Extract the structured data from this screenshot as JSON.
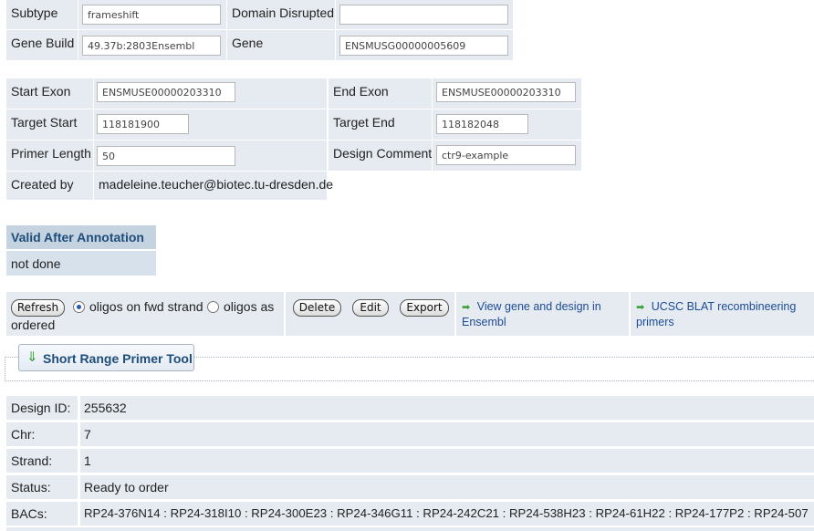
{
  "top_table": {
    "subtype_label": "Subtype",
    "subtype_value": "frameshift",
    "domain_label": "Domain Disrupted",
    "domain_value": "",
    "gene_build_label": "Gene Build",
    "gene_build_value": "49.37b:2803Ensembl",
    "gene_label": "Gene",
    "gene_value": "ENSMUSG00000005609"
  },
  "design_table": {
    "start_exon_label": "Start Exon",
    "start_exon_value": "ENSMUSE00000203310",
    "end_exon_label": "End Exon",
    "end_exon_value": "ENSMUSE00000203310",
    "target_start_label": "Target Start",
    "target_start_value": "118181900",
    "target_end_label": "Target End",
    "target_end_value": "118182048",
    "primer_length_label": "Primer Length",
    "primer_length_value": "50",
    "design_comment_label": "Design Comment",
    "design_comment_value": "ctr9-example",
    "created_by_label": "Created by",
    "created_by_value": "madeleine.teucher@biotec.tu-dresden.de"
  },
  "annotation": {
    "header": "Valid After Annotation",
    "value": "not done"
  },
  "toolbar": {
    "refresh_label": "Refresh",
    "radio_fwd_label": "oligos on fwd strand",
    "radio_ordered_label_1": "oligos as",
    "radio_ordered_label_2": "ordered",
    "delete_label": "Delete",
    "edit_label": "Edit",
    "export_label": "Export",
    "ensembl_link_1": "View gene and design in",
    "ensembl_link_2": "Ensembl",
    "ucsc_link_1": "UCSC BLAT recombineering",
    "ucsc_link_2": "primers",
    "selected_radio": "fwd"
  },
  "tool": {
    "short_range_label": "Short Range Primer Tool"
  },
  "info": {
    "design_id_label": "Design ID:",
    "design_id_value": "255632",
    "chr_label": "Chr:",
    "chr_value": "7",
    "strand_label": "Strand:",
    "strand_value": "1",
    "status_label": "Status:",
    "status_value": "Ready to order",
    "bacs_label": "BACs:",
    "bacs_value": "RP24-376N14 : RP24-318I10 : RP24-300E23 : RP24-346G11 : RP24-242C21 : RP24-538H23 : RP24-61H22 : RP24-177P2 : RP24-507"
  },
  "colors": {
    "cell_bg": "#e6ebf2",
    "status_header_bg": "#c5d2e0",
    "link": "#1c4b95",
    "arrow_green": "#33a033"
  },
  "icons": {
    "link_arrow": "green-right-arrow-icon",
    "tool_arrow": "green-down-arrow-icon"
  }
}
